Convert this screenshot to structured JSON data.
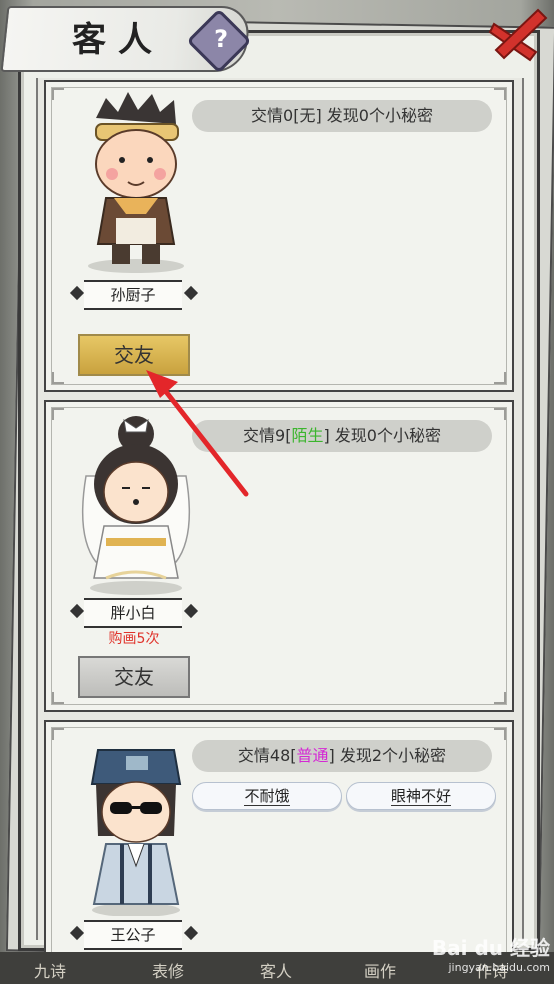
{
  "header": {
    "title": "客人",
    "help_icon": "question-icon",
    "close_icon": "close-icon"
  },
  "guests": [
    {
      "name": "孙厨子",
      "info_prefix": "交情0[",
      "relation": "无",
      "info_suffix": "] 发现0个小秘密",
      "button_label": "交友",
      "button_state": "active"
    },
    {
      "name": "胖小白",
      "info_prefix": "交情9[",
      "relation": "陌生",
      "info_suffix": "] 发现0个小秘密",
      "relation_color": "#3bb52d",
      "note": "购画5次",
      "button_label": "交友",
      "button_state": "disabled"
    },
    {
      "name": "王公子",
      "info_prefix": "交情48[",
      "relation": "普通",
      "info_suffix": "] 发现2个小秘密",
      "relation_color": "#d428d4",
      "secrets": [
        "不耐饿",
        "眼神不好"
      ]
    }
  ],
  "bottom_nav": [
    "九诗",
    "表修",
    "客人",
    "画作",
    "作诗"
  ],
  "watermark": {
    "brand": "Bai du 经验",
    "url": "jingyan.baidu.com"
  }
}
